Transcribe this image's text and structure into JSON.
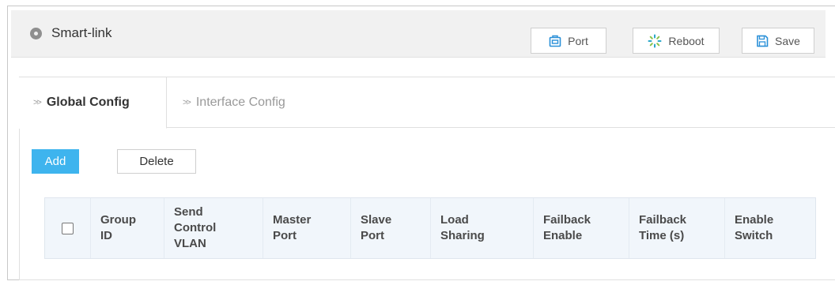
{
  "header": {
    "title": "Smart-link",
    "title_icon": "location-pin-icon",
    "buttons": {
      "port": "Port",
      "reboot": "Reboot",
      "save": "Save"
    }
  },
  "tabs": [
    {
      "label": "Global Config",
      "active": true
    },
    {
      "label": "Interface Config",
      "active": false
    }
  ],
  "actions": {
    "add": "Add",
    "delete": "Delete"
  },
  "table": {
    "columns": [
      {
        "line1": "Group",
        "line2": "ID",
        "line3": ""
      },
      {
        "line1": "Send",
        "line2": "Control",
        "line3": "VLAN"
      },
      {
        "line1": "Master",
        "line2": "Port",
        "line3": ""
      },
      {
        "line1": "Slave",
        "line2": "Port",
        "line3": ""
      },
      {
        "line1": "Load",
        "line2": "Sharing",
        "line3": ""
      },
      {
        "line1": "Failback",
        "line2": "Enable",
        "line3": ""
      },
      {
        "line1": "Failback",
        "line2": "Time (s)",
        "line3": ""
      },
      {
        "line1": "Enable",
        "line2": "Switch",
        "line3": ""
      }
    ],
    "rows": []
  },
  "colors": {
    "accent": "#3eb4ee",
    "header_bg": "#f1f6fb",
    "topbar_bg": "#f1f1f1"
  }
}
